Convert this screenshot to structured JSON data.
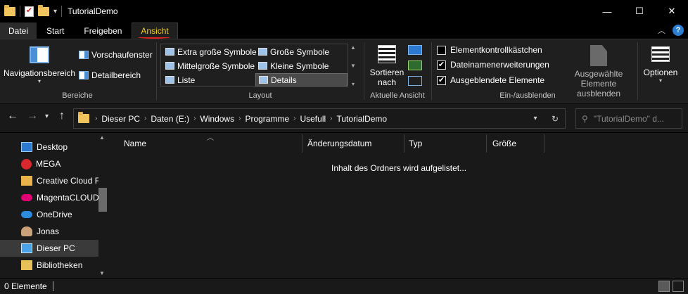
{
  "window": {
    "title": "TutorialDemo",
    "controls": [
      "—",
      "☐",
      "✕"
    ]
  },
  "tabs": [
    {
      "label": "Datei"
    },
    {
      "label": "Start"
    },
    {
      "label": "Freigeben"
    },
    {
      "label": "Ansicht"
    }
  ],
  "ribbon": {
    "bereiche": {
      "label": "Bereiche",
      "navigationsbereich": "Navigationsbereich",
      "vorschaufenster": "Vorschaufenster",
      "detailbereich": "Detailbereich"
    },
    "layout": {
      "label": "Layout",
      "items": [
        "Extra große Symbole",
        "Große Symbole",
        "Mittelgroße Symbole",
        "Kleine Symbole",
        "Liste",
        "Details"
      ],
      "selected": "Details"
    },
    "aktuelle_ansicht": {
      "label": "Aktuelle Ansicht",
      "sortieren_line1": "Sortieren",
      "sortieren_line2": "nach"
    },
    "einausblenden": {
      "label": "Ein-/ausblenden",
      "checkboxes": [
        {
          "label": "Elementkontrollkästchen",
          "checked": false
        },
        {
          "label": "Dateinamenerweiterungen",
          "checked": true
        },
        {
          "label": "Ausgeblendete Elemente",
          "checked": true
        }
      ],
      "hide_selected_line1": "Ausgewählte",
      "hide_selected_line2": "Elemente ausblenden"
    },
    "optionen": "Optionen"
  },
  "address": {
    "path": [
      "Dieser PC",
      "Daten (E:)",
      "Windows",
      "Programme",
      "Usefull",
      "TutorialDemo"
    ],
    "search_placeholder": "\"TutorialDemo\" d..."
  },
  "navpane": {
    "items": [
      {
        "label": "Desktop",
        "icon": "desktop-icon",
        "color": "#2b79d0"
      },
      {
        "label": "MEGA",
        "icon": "mega-icon",
        "color": "#d9272e"
      },
      {
        "label": "Creative Cloud F",
        "icon": "creative-cloud-icon",
        "color": "#e8b44a"
      },
      {
        "label": "MagentaCLOUD",
        "icon": "magenta-cloud-icon",
        "color": "#e20074"
      },
      {
        "label": "OneDrive",
        "icon": "onedrive-icon",
        "color": "#2b8be0"
      },
      {
        "label": "Jonas",
        "icon": "user-icon",
        "color": "#c9a27a"
      },
      {
        "label": "Dieser PC",
        "icon": "pc-icon",
        "color": "#4aa3e8"
      },
      {
        "label": "Bibliotheken",
        "icon": "library-icon",
        "color": "#e8c05a"
      }
    ],
    "selected": "Dieser PC"
  },
  "content": {
    "columns": [
      "Name",
      "Änderungsdatum",
      "Typ",
      "Größe"
    ],
    "empty_message": "Inhalt des Ordners wird aufgelistet..."
  },
  "status": {
    "count": "0 Elemente"
  }
}
